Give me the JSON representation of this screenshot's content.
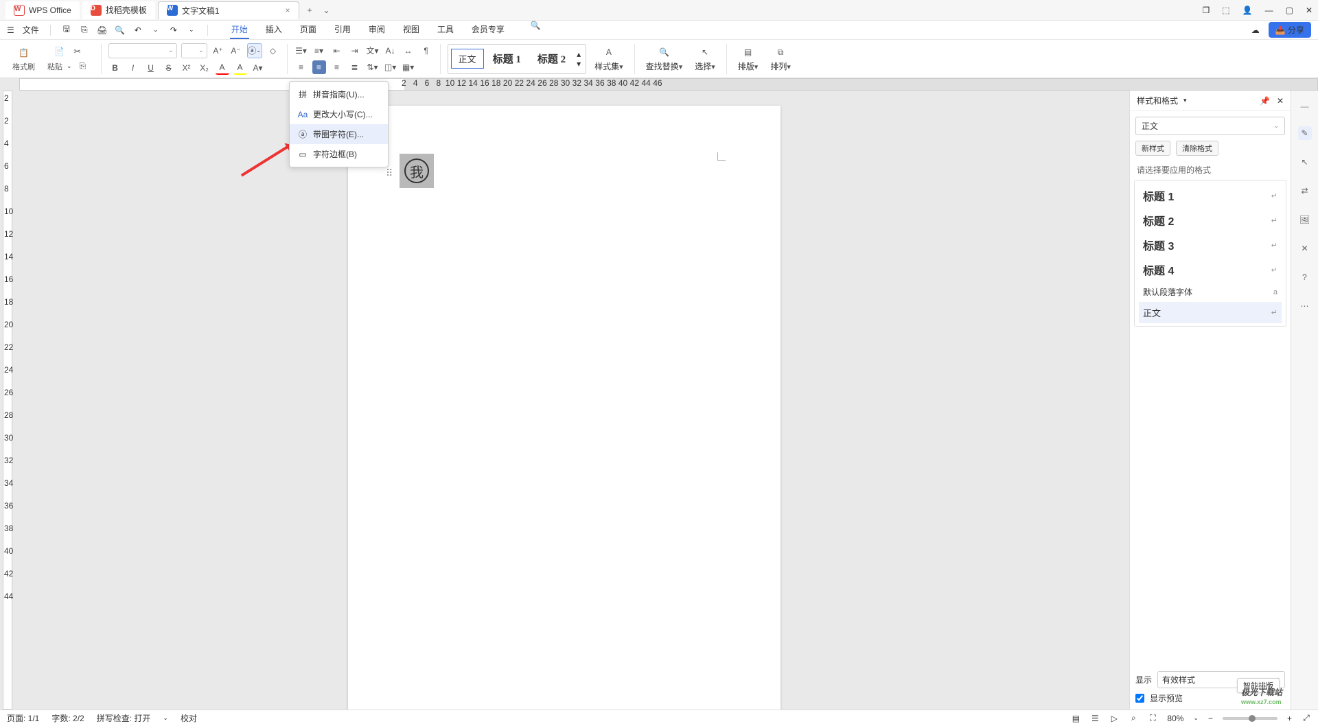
{
  "titlebar": {
    "app_tab": "WPS Office",
    "template_tab": "找稻壳模板",
    "doc_tab": "文字文稿1",
    "close_char": "×",
    "plus_char": "+",
    "dropdown_char": "⌄"
  },
  "window_controls": {
    "box": "❐",
    "cube": "⬚",
    "user": "👤",
    "min": "—",
    "max": "▢",
    "close": "✕"
  },
  "menubar": {
    "file": "文件",
    "tabs": [
      "开始",
      "插入",
      "页面",
      "引用",
      "审阅",
      "视图",
      "工具",
      "会员专享"
    ],
    "active_tab_index": 0,
    "share": "分享",
    "cloud_icon": "☁"
  },
  "quick_access": {
    "menu": "☰",
    "save": "🖫",
    "export": "⎘",
    "print": "🖨",
    "preview": "🔍",
    "undo": "↶",
    "redo": "↷"
  },
  "ribbon": {
    "format_painter": "格式刷",
    "paste": "粘贴",
    "bold": "B",
    "italic": "I",
    "underline": "U",
    "strike": "S",
    "sup": "X²",
    "sub": "X₂",
    "fontcolor": "A",
    "highlight": "A",
    "align_center_sel": true,
    "styles_gallery": {
      "body": "正文",
      "h1": "标题 1",
      "h2": "标题 2"
    },
    "style_set": "样式集",
    "find_replace": "查找替换",
    "select": "选择",
    "layout": "排版",
    "arrange": "排列"
  },
  "dropdown": {
    "items": [
      {
        "icon": "拼",
        "label": "拼音指南(U)..."
      },
      {
        "icon": "Aa",
        "label": "更改大小写(C)..."
      },
      {
        "icon": "ⓐ",
        "label": "带圈字符(E)..."
      },
      {
        "icon": "▭",
        "label": "字符边框(B)"
      }
    ],
    "hover_index": 2
  },
  "document": {
    "circled_char": "我"
  },
  "ruler_numbers": [
    "2",
    "4",
    "6",
    "8",
    "10",
    "12",
    "14",
    "16",
    "18",
    "20",
    "22",
    "24",
    "26",
    "28",
    "30",
    "32",
    "34",
    "36",
    "38",
    "40",
    "42",
    "44",
    "46"
  ],
  "vruler_numbers": [
    "2",
    "2",
    "4",
    "6",
    "8",
    "10",
    "12",
    "14",
    "16",
    "18",
    "20",
    "22",
    "24",
    "26",
    "28",
    "30",
    "32",
    "34",
    "36",
    "38",
    "40",
    "42",
    "44"
  ],
  "styles_panel": {
    "title": "样式和格式",
    "current": "正文",
    "new_style": "新样式",
    "clear_format": "清除格式",
    "hint": "请选择要应用的格式",
    "items": [
      {
        "name": "标题 1",
        "kind": "h"
      },
      {
        "name": "标题 2",
        "kind": "h"
      },
      {
        "name": "标题 3",
        "kind": "h"
      },
      {
        "name": "标题 4",
        "kind": "h"
      },
      {
        "name": "默认段落字体",
        "kind": "def"
      },
      {
        "name": "正文",
        "kind": "body",
        "selected": true
      }
    ],
    "show_label": "显示",
    "show_value": "有效样式",
    "preview_check": "显示预览",
    "smart_layout": "智能排版"
  },
  "statusbar": {
    "page": "页面: 1/1",
    "words": "字数: 2/2",
    "spell": "拼写检查: 打开",
    "proof": "校对",
    "zoom": "80%"
  },
  "side_icons": [
    "✎",
    "↖",
    "⇄",
    "🖼",
    "✕",
    "?",
    "⋯"
  ],
  "watermark": {
    "name": "极光下载站",
    "url": "www.xz7.com"
  }
}
